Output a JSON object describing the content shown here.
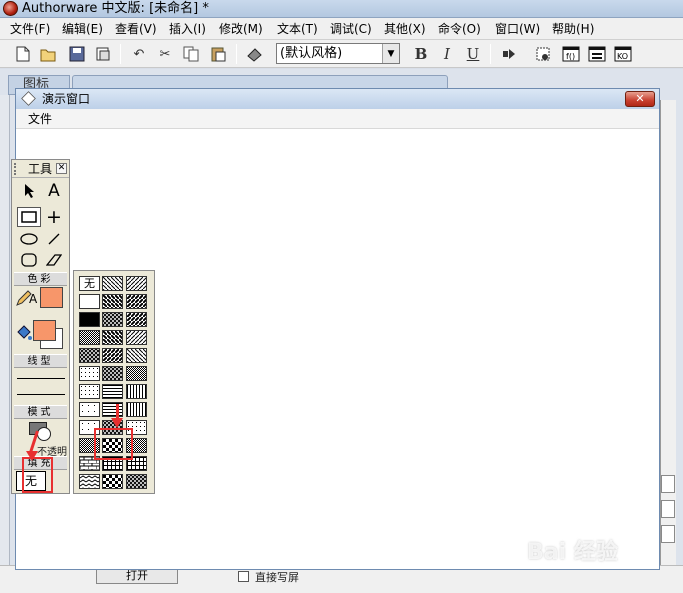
{
  "app": {
    "title": "Authorware 中文版: [未命名] *"
  },
  "menu": [
    "文件(F)",
    "编辑(E)",
    "查看(V)",
    "插入(I)",
    "修改(M)",
    "文本(T)",
    "调试(C)",
    "其他(X)",
    "命令(O)",
    "窗口(W)",
    "帮助(H)"
  ],
  "toolbar": {
    "style_value": "(默认风格)",
    "bold": "B",
    "italic": "I",
    "underline": "U"
  },
  "background_panel": {
    "label": "图标"
  },
  "demo_window": {
    "title": "演示窗口",
    "close": "✕",
    "menu": "文件"
  },
  "tools": {
    "title": "工具",
    "close": "✕",
    "sections": {
      "color": "色彩",
      "line": "线型",
      "mode": "模式",
      "fill": "填充"
    },
    "mode_value": "不透明",
    "fill_value": "无"
  },
  "pattern_palette": {
    "none_label": "无"
  },
  "bottom": {
    "checkbox_label": "直接写屏",
    "button_label": "打开"
  },
  "colors": {
    "swatch": "#f7966a",
    "annotation": "#e83030"
  },
  "watermark": "Bai 经验"
}
